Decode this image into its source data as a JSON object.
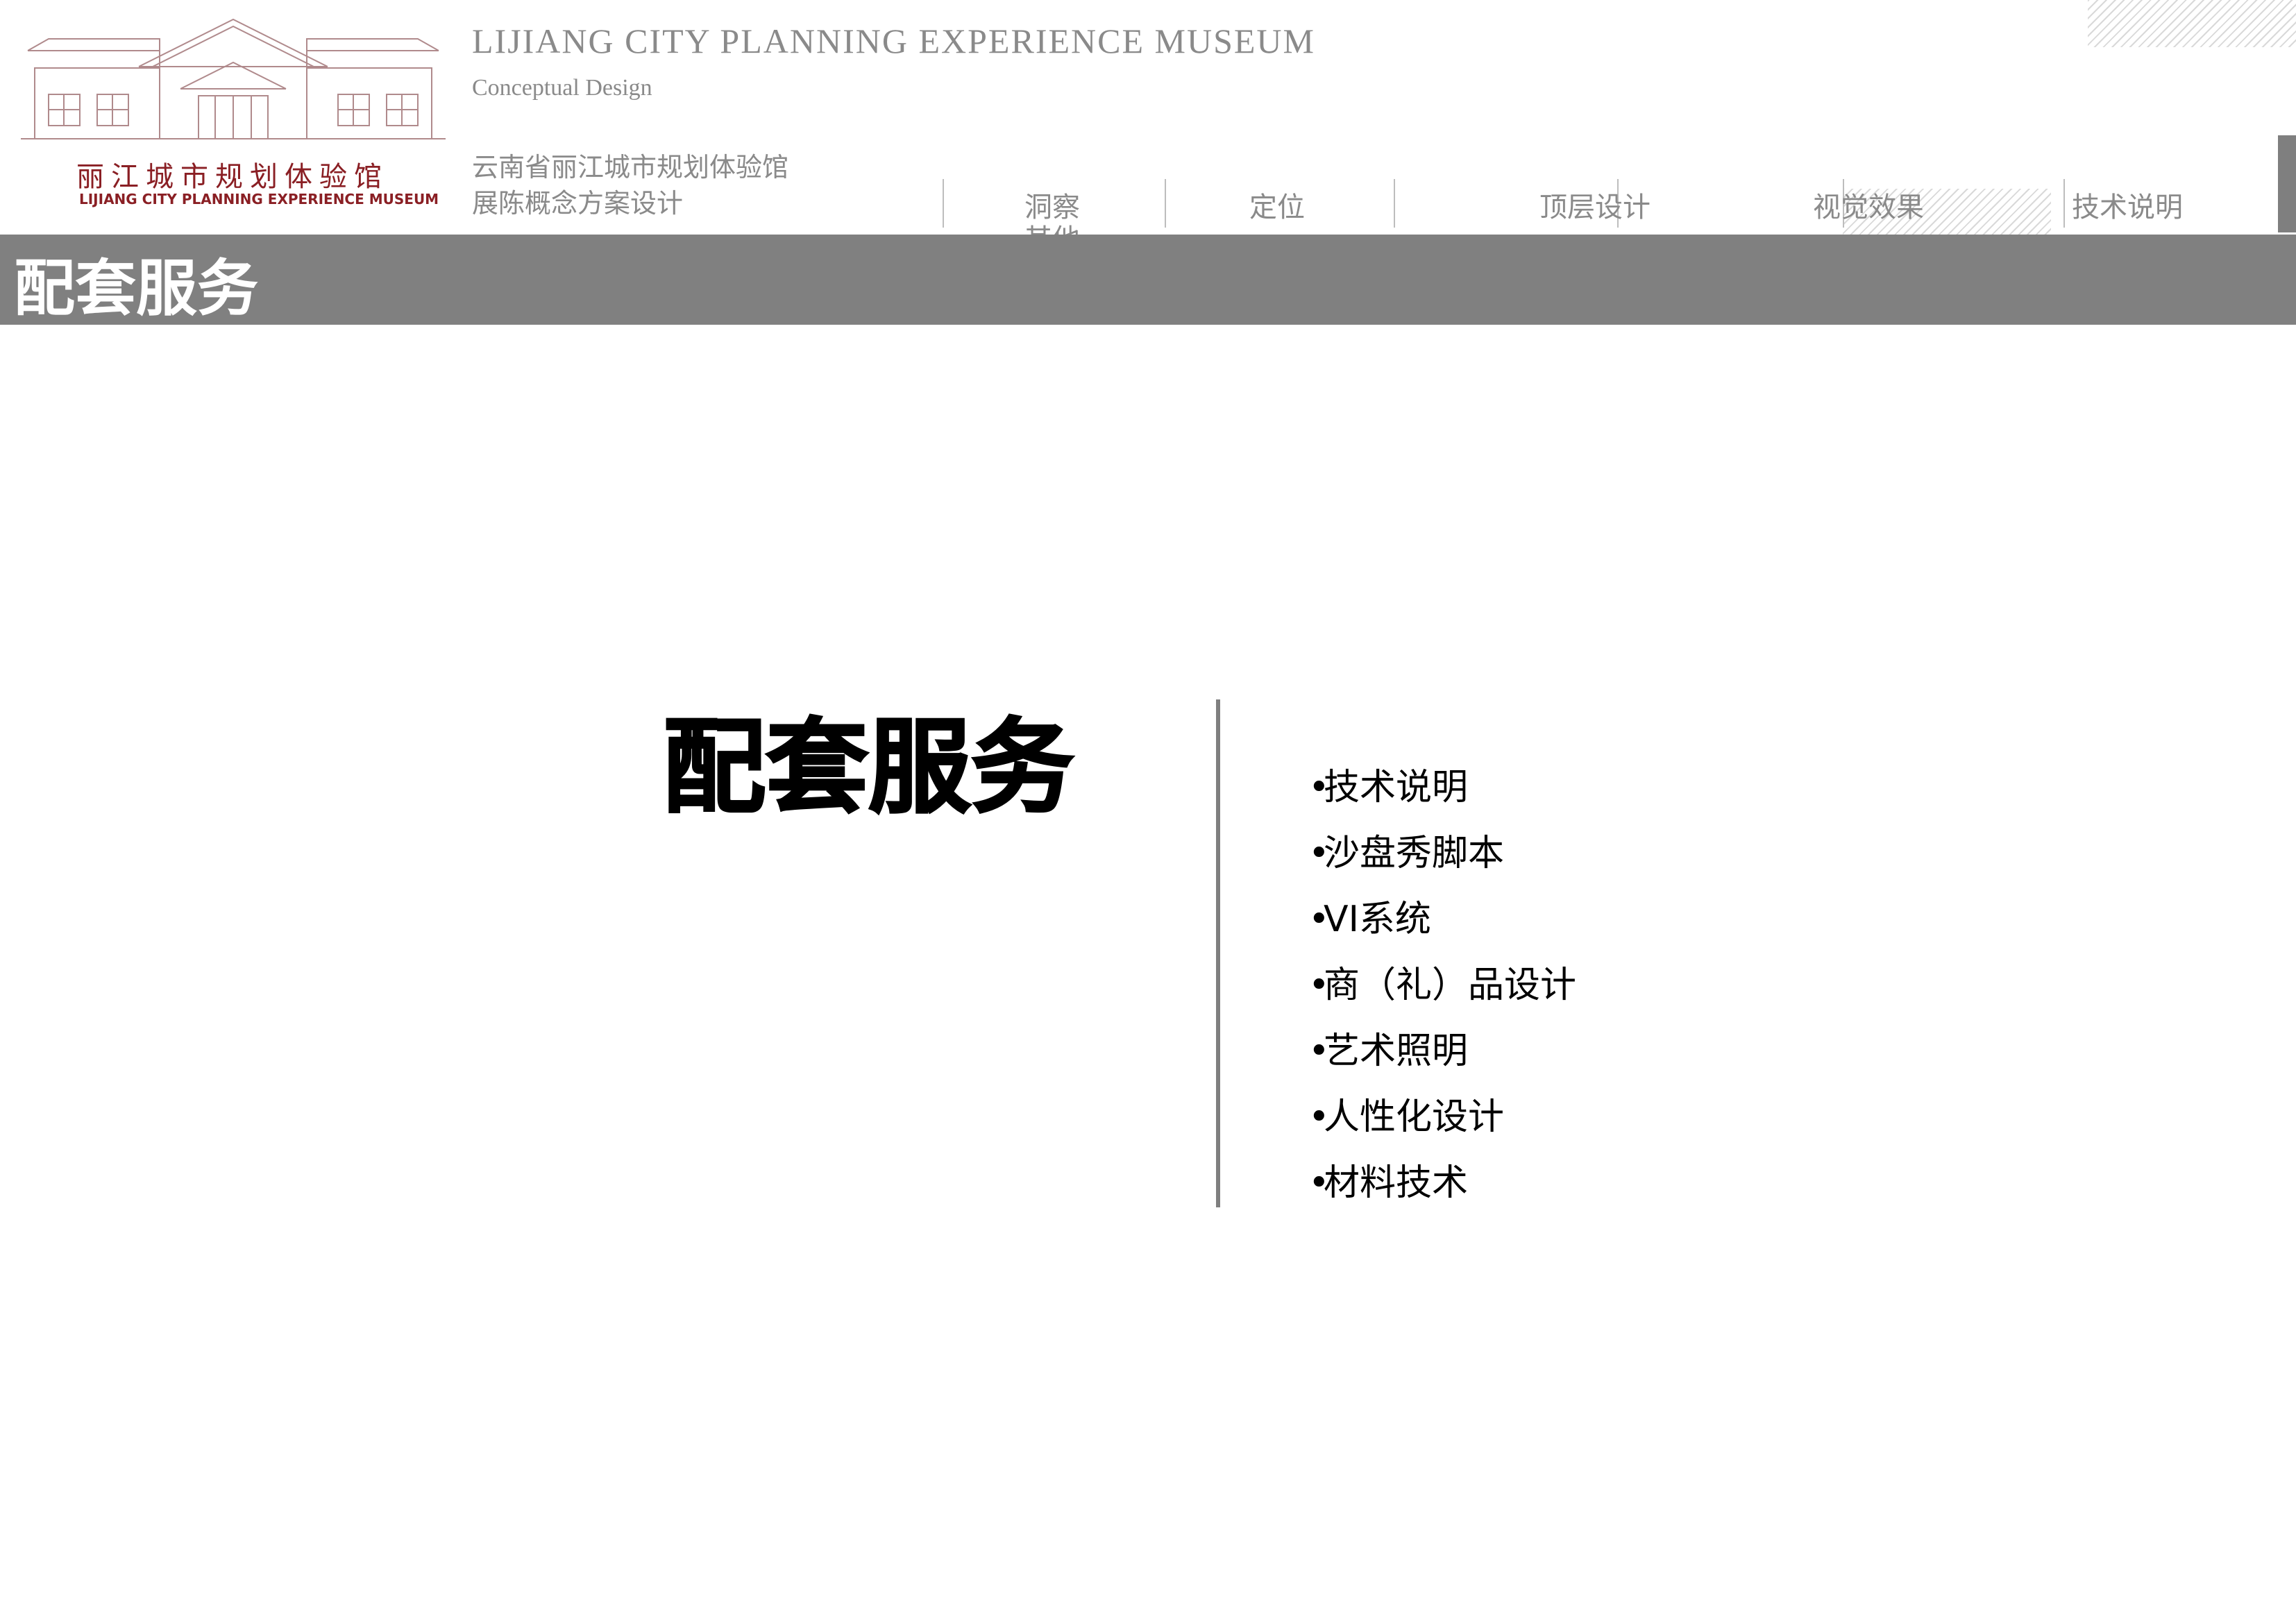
{
  "header": {
    "logo_text_cn": "丽江城市规划体验馆",
    "logo_text_en": "LIJIANG CITY PLANNING EXPERIENCE MUSEUM",
    "title_en": "LIJIANG CITY PLANNING EXPERIENCE MUSEUM",
    "subtitle_en": "Conceptual Design",
    "title_cn_line1": "云南省丽江城市规划体验馆",
    "title_cn_line2": "展陈概念方案设计",
    "brand_color": "#8a1f24"
  },
  "nav": {
    "items": [
      {
        "label": "洞察",
        "sub": "其他"
      },
      {
        "label": "定位"
      },
      {
        "label": "顶层设计"
      },
      {
        "label": "视觉效果"
      },
      {
        "label": "技术说明"
      }
    ]
  },
  "section": {
    "band_title": "配套服务",
    "band_color": "#808080"
  },
  "main": {
    "heading": "配套服务",
    "bullet": "•",
    "items": [
      "技术说明",
      "沙盘秀脚本",
      "VI系统",
      "商（礼）品设计",
      "艺术照明",
      "人性化设计",
      "材料技术"
    ]
  }
}
